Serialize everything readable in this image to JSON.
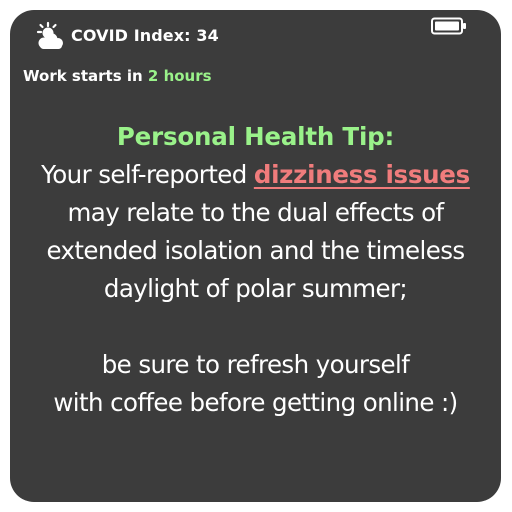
{
  "status_bar": {
    "weather_icon": "partly-cloudy-icon",
    "covid_index_label": "COVID Index: 34",
    "battery_icon": "battery-icon"
  },
  "schedule": {
    "prefix": "Work starts in ",
    "time": "2 hours"
  },
  "tip": {
    "title": "Personal Health Tip:",
    "line1_prefix": "Your self-reported ",
    "line1_highlight": "dizziness issues",
    "line2": "may relate to the dual effects of",
    "line3": "extended isolation and the timeless",
    "line4": "daylight of polar summer;",
    "line5": "be sure to refresh yourself",
    "line6": "with coffee before getting online :)"
  },
  "colors": {
    "background": "#3c3c3c",
    "accent_green": "#9af28a",
    "highlight_red": "#f07c7c"
  }
}
